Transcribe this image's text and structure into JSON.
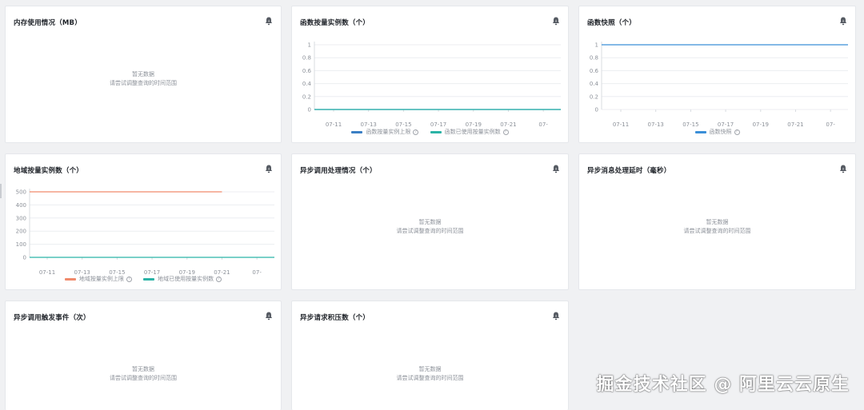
{
  "empty": {
    "line1": "暂无数据",
    "line2": "请尝试调整查询的时间范围"
  },
  "cards": {
    "memory": {
      "title": "内存使用情况（MB）"
    },
    "fn_instances": {
      "title": "函数按量实例数（个）",
      "legend": [
        "函数按量实例上限",
        "函数已使用按量实例数"
      ]
    },
    "fn_snapshot": {
      "title": "函数快照（个）",
      "legend": [
        "函数快照"
      ]
    },
    "region_instances": {
      "title": "地域按量实例数（个）",
      "legend": [
        "地域按量实例上限",
        "地域已使用按量实例数"
      ]
    },
    "async_process": {
      "title": "异步调用处理情况（个）"
    },
    "async_latency": {
      "title": "异步消息处理延时（毫秒）"
    },
    "async_trigger": {
      "title": "异步调用触发事件（次）"
    },
    "async_backlog": {
      "title": "异步请求积压数（个）"
    }
  },
  "chart_data": [
    {
      "id": "fn_instances",
      "type": "line",
      "x": [
        "07-11",
        "07-13",
        "07-15",
        "07-17",
        "07-19",
        "07-21",
        "07-"
      ],
      "yticks": [
        "0",
        "0.2",
        "0.4",
        "0.6",
        "0.8",
        "1"
      ],
      "ylim": [
        0,
        1
      ],
      "series": [
        {
          "name": "函数按量实例上限",
          "color": "#3b7fc4",
          "values": [
            0,
            0,
            0,
            0,
            0,
            0,
            0
          ]
        },
        {
          "name": "函数已使用按量实例数",
          "color": "#2bb3a6",
          "values": [
            0,
            0,
            0,
            0,
            0,
            0,
            0
          ]
        }
      ]
    },
    {
      "id": "fn_snapshot",
      "type": "line",
      "x": [
        "07-11",
        "07-13",
        "07-15",
        "07-17",
        "07-19",
        "07-21",
        "07-"
      ],
      "yticks": [
        "0",
        "0.2",
        "0.4",
        "0.6",
        "0.8",
        "1"
      ],
      "ylim": [
        0,
        1
      ],
      "series": [
        {
          "name": "函数快照",
          "color": "#3b8fd8",
          "values": [
            1,
            1,
            1,
            1,
            1,
            1,
            1
          ]
        }
      ]
    },
    {
      "id": "region_instances",
      "type": "line",
      "x": [
        "07-11",
        "07-13",
        "07-15",
        "07-17",
        "07-19",
        "07-21",
        "07-"
      ],
      "yticks": [
        "0",
        "100",
        "200",
        "300",
        "400",
        "500"
      ],
      "ylim": [
        0,
        500
      ],
      "series": [
        {
          "name": "地域按量实例上限",
          "color": "#f08a6c",
          "values": [
            500,
            500,
            500,
            500,
            500,
            500
          ]
        },
        {
          "name": "地域已使用按量实例数",
          "color": "#2bb3a6",
          "values": [
            0,
            0,
            0,
            0,
            0,
            0,
            0
          ]
        }
      ]
    }
  ],
  "watermark": "掘金技术社区 @ 阿里云云原生"
}
